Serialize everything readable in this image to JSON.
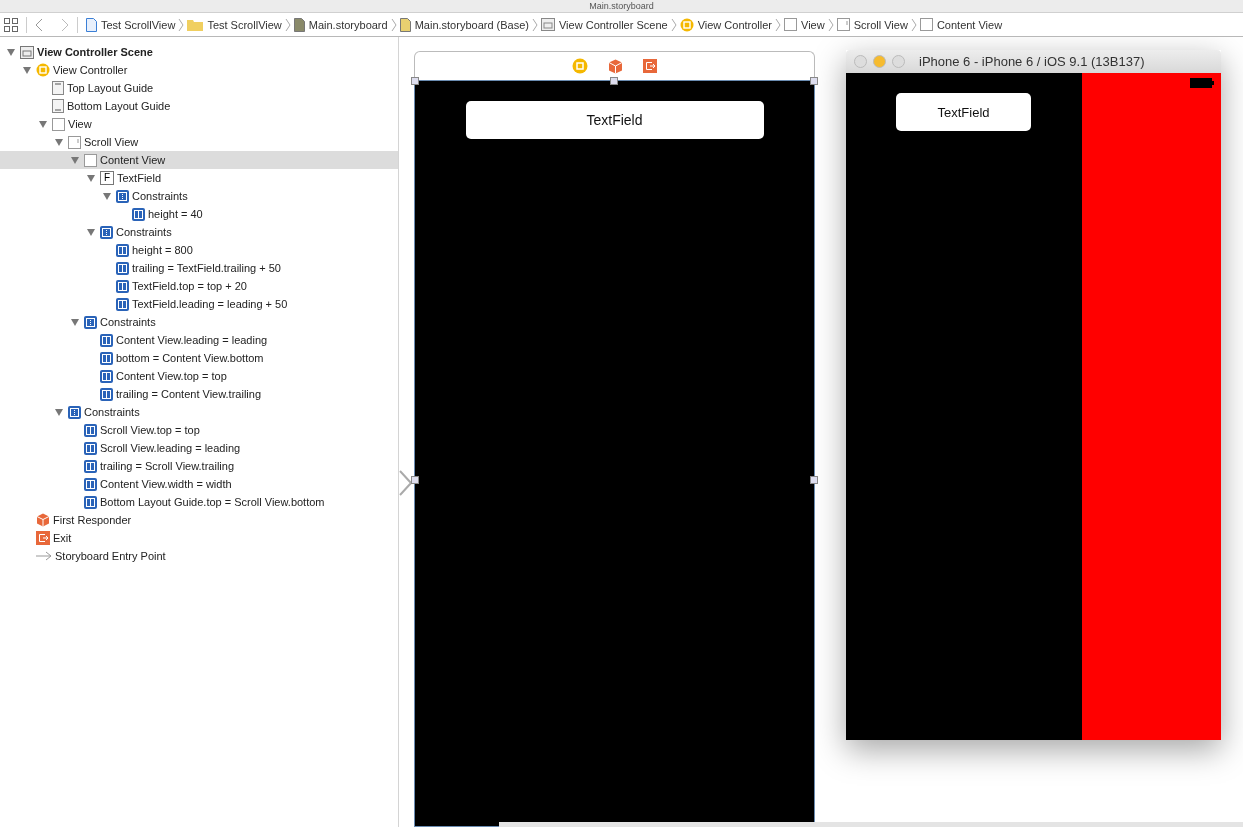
{
  "window": {
    "title": "Main.storyboard"
  },
  "jump_bar": {
    "items": [
      {
        "label": "Test ScrollView",
        "kind": "project"
      },
      {
        "label": "Test ScrollView",
        "kind": "folder"
      },
      {
        "label": "Main.storyboard",
        "kind": "storyboard"
      },
      {
        "label": "Main.storyboard (Base)",
        "kind": "storyboard-base"
      },
      {
        "label": "View Controller Scene",
        "kind": "scene"
      },
      {
        "label": "View Controller",
        "kind": "controller"
      },
      {
        "label": "View",
        "kind": "view"
      },
      {
        "label": "Scroll View",
        "kind": "scroll"
      },
      {
        "label": "Content View",
        "kind": "view"
      }
    ]
  },
  "outline": {
    "items": [
      {
        "label": "View Controller Scene",
        "kind": "scene",
        "selected": false,
        "expanded": true,
        "children": [
          {
            "label": "View Controller",
            "kind": "controller",
            "selected": false,
            "expanded": true,
            "children": [
              {
                "label": "Top Layout Guide",
                "kind": "guide-top",
                "selected": false
              },
              {
                "label": "Bottom Layout Guide",
                "kind": "guide-bottom",
                "selected": false
              },
              {
                "label": "View",
                "kind": "view",
                "selected": false,
                "expanded": true,
                "children": [
                  {
                    "label": "Scroll View",
                    "kind": "scroll",
                    "selected": false,
                    "expanded": true,
                    "children": [
                      {
                        "label": "Content View",
                        "kind": "view",
                        "selected": true,
                        "expanded": true,
                        "children": [
                          {
                            "label": "TextField",
                            "kind": "textfield",
                            "badge": "F",
                            "selected": false,
                            "expanded": true,
                            "children": [
                              {
                                "label": "Constraints",
                                "kind": "constraints",
                                "selected": false,
                                "expanded": true,
                                "children": [
                                  {
                                    "label": "height = 40",
                                    "kind": "constraint",
                                    "selected": false
                                  }
                                ]
                              }
                            ]
                          },
                          {
                            "label": "Constraints",
                            "kind": "constraints",
                            "selected": false,
                            "expanded": true,
                            "children": [
                              {
                                "label": "height = 800",
                                "kind": "constraint",
                                "selected": false
                              },
                              {
                                "label": "trailing = TextField.trailing + 50",
                                "kind": "constraint",
                                "selected": false
                              },
                              {
                                "label": "TextField.top = top + 20",
                                "kind": "constraint",
                                "selected": false
                              },
                              {
                                "label": "TextField.leading = leading + 50",
                                "kind": "constraint",
                                "selected": false
                              }
                            ]
                          }
                        ]
                      },
                      {
                        "label": "Constraints",
                        "kind": "constraints",
                        "selected": false,
                        "expanded": true,
                        "children": [
                          {
                            "label": "Content View.leading = leading",
                            "kind": "constraint",
                            "selected": false
                          },
                          {
                            "label": "bottom = Content View.bottom",
                            "kind": "constraint",
                            "selected": false
                          },
                          {
                            "label": "Content View.top = top",
                            "kind": "constraint",
                            "selected": false
                          },
                          {
                            "label": "trailing = Content View.trailing",
                            "kind": "constraint",
                            "selected": false
                          }
                        ]
                      }
                    ]
                  },
                  {
                    "label": "Constraints",
                    "kind": "constraints",
                    "selected": false,
                    "expanded": true,
                    "children": [
                      {
                        "label": "Scroll View.top = top",
                        "kind": "constraint",
                        "selected": false
                      },
                      {
                        "label": "Scroll View.leading = leading",
                        "kind": "constraint",
                        "selected": false
                      },
                      {
                        "label": "trailing = Scroll View.trailing",
                        "kind": "constraint",
                        "selected": false
                      },
                      {
                        "label": "Content View.width = width",
                        "kind": "constraint",
                        "selected": false
                      },
                      {
                        "label": "Bottom Layout Guide.top = Scroll View.bottom",
                        "kind": "constraint",
                        "selected": false
                      }
                    ]
                  }
                ]
              }
            ]
          },
          {
            "label": "First Responder",
            "kind": "responder",
            "selected": false
          },
          {
            "label": "Exit",
            "kind": "exit",
            "selected": false
          },
          {
            "label": "Storyboard Entry Point",
            "kind": "entry",
            "selected": false
          }
        ]
      }
    ]
  },
  "canvas": {
    "scene": {
      "text_field": {
        "text": "TextField"
      }
    },
    "simulator": {
      "title": "iPhone 6 - iPhone 6 / iOS 9.1 (13B137)",
      "text_field": {
        "text": "TextField"
      }
    }
  }
}
